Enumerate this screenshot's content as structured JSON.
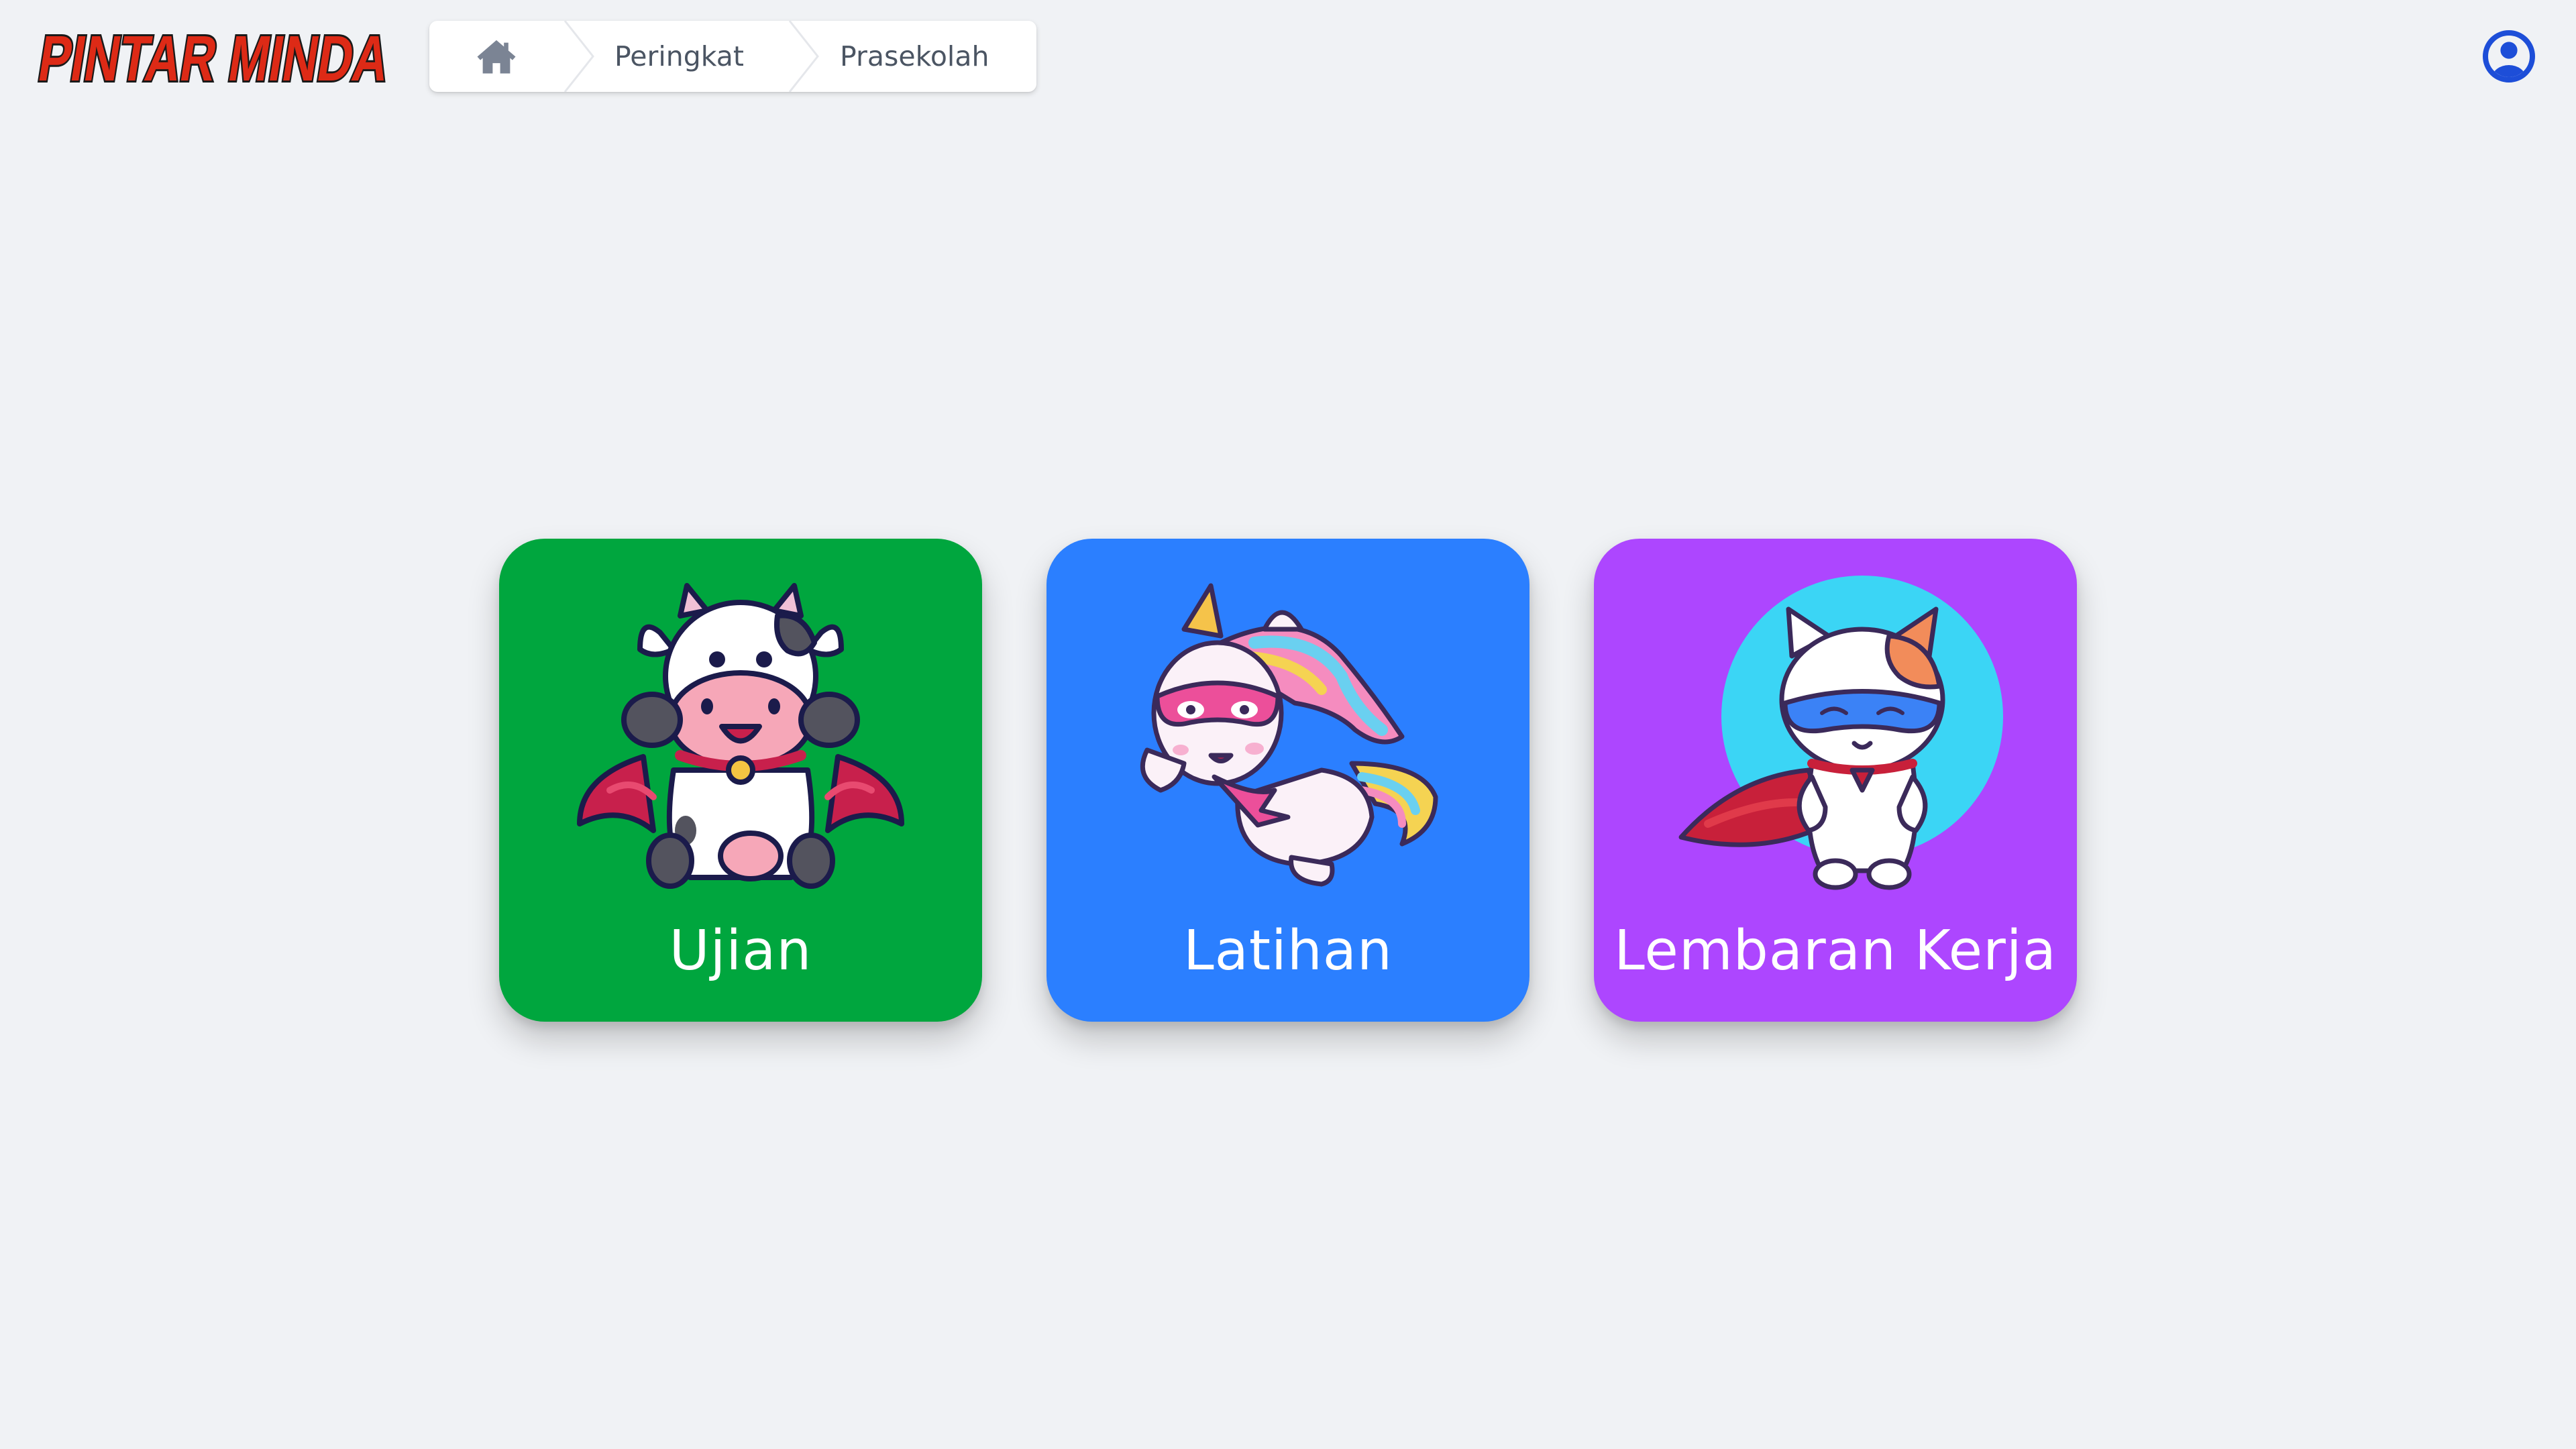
{
  "header": {
    "logo": {
      "text": "PINTAR MINDA",
      "fill_color": "#dd2a16",
      "outline_color": "#1a1a1a"
    },
    "breadcrumb": {
      "home_icon": "home-icon",
      "items": [
        {
          "label": "Peringkat"
        },
        {
          "label": "Prasekolah"
        }
      ]
    },
    "account_icon": "user-circle-icon",
    "account_color": "#1d4ed8"
  },
  "cards": [
    {
      "label": "Ujian",
      "color": "#00a63e",
      "illustration": "superhero-cow"
    },
    {
      "label": "Latihan",
      "color": "#2b7fff",
      "illustration": "superhero-unicorn"
    },
    {
      "label": "Lembaran Kerja",
      "color": "#ad46ff",
      "illustration": "superhero-cat"
    }
  ]
}
